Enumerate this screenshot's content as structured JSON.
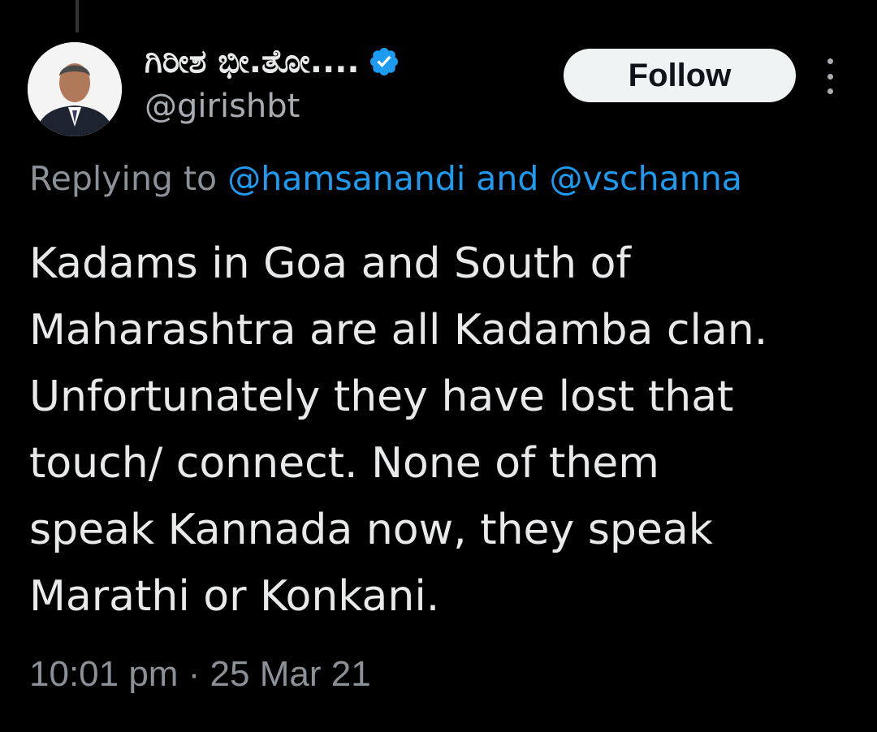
{
  "tweet": {
    "author": {
      "display_name": "ಗಿರೀಶ ಭೀ.ತೋ....",
      "handle": "@girishbt",
      "verified": true
    },
    "follow_label": "Follow",
    "replying_to": {
      "prefix": "Replying to",
      "mention_1": "@hamsanandi",
      "conjunction": "and",
      "mention_2": "@vschanna"
    },
    "text_lines": [
      "Kadams in Goa and South of",
      "Maharashtra are all Kadamba clan.",
      "Unfortunately they have lost that",
      "touch/ connect. None of them",
      "speak Kannada now, they speak",
      "Marathi or Konkani."
    ],
    "timestamp": "10:01 pm · 25 Mar 21"
  },
  "colors": {
    "background": "#000000",
    "text": "#e7e9ea",
    "secondary": "#8b9196",
    "link": "#1d9bf0",
    "verified": "#1d9bf0",
    "follow_bg": "#eff3f4"
  },
  "icons": {
    "verified": "verified-badge-icon",
    "more": "more-options-icon"
  }
}
